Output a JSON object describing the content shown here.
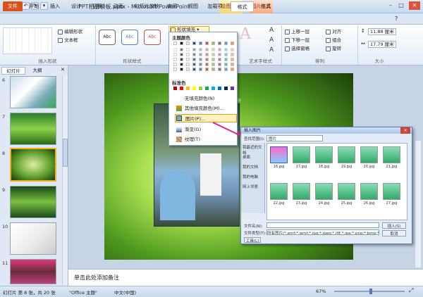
{
  "title_bar": {
    "title": "PPT相册模板.pptx - Microsoft PowerPoint",
    "context_tabs": [
      "绘图工具",
      "图片工具"
    ]
  },
  "tabs": [
    "文件",
    "开始",
    "插入",
    "设计",
    "切换",
    "动画",
    "幻灯片放映",
    "审阅",
    "视图",
    "加载项",
    "格式",
    "格式"
  ],
  "ribbon": {
    "groups": [
      "插入形状",
      "形状样式",
      "艺术字样式",
      "排列",
      "大小"
    ],
    "edit_shape": "编辑形状",
    "text_box": "文本框",
    "style_labels": [
      "Abc",
      "Abc",
      "Abc"
    ],
    "shape_fill": "形状填充",
    "arrange": {
      "bring_forward": "上移一层",
      "send_backward": "下移一层",
      "selection_pane": "选择窗格",
      "align": "对齐",
      "group": "组合",
      "rotate": "旋转"
    },
    "size": {
      "height": "11.88 厘米",
      "width": "17.79 厘米"
    }
  },
  "fill_menu": {
    "theme_colors": "主题颜色",
    "standard_colors": "标准色",
    "items": [
      "无填充颜色(N)",
      "其他填充颜色(M)...",
      "图片(P)...",
      "渐变(G)",
      "纹理(T)"
    ],
    "theme_palette": [
      "#ffffff",
      "#000000",
      "#eeece1",
      "#1f497d",
      "#4f81bd",
      "#c0504d",
      "#9bbb59",
      "#8064a2",
      "#4bacc6",
      "#f79646"
    ],
    "standard_palette": [
      "#c00000",
      "#ff0000",
      "#ffc000",
      "#ffff00",
      "#92d050",
      "#00b050",
      "#00b0f0",
      "#0070c0",
      "#002060",
      "#7030a0"
    ]
  },
  "slide_panel": {
    "tabs": [
      "幻灯片",
      "大纲"
    ],
    "numbers": [
      "6",
      "7",
      "8",
      "9",
      "10",
      "11"
    ]
  },
  "notes_placeholder": "单击此处添加备注",
  "status": {
    "slide": "幻灯片 第 8 张，共 20 张",
    "theme": "\"Office 主题\"",
    "language": "中文(中国)",
    "zoom": "67%"
  },
  "dialog": {
    "title": "插入图片",
    "look_in_label": "查找范围(I):",
    "look_in": "图片",
    "sidebar": [
      "我最近的文档",
      "桌面",
      "我的文档",
      "我的电脑",
      "网上邻居"
    ],
    "files": [
      "16.jpg",
      "17.jpg",
      "18.jpg",
      "19.jpg",
      "20.jpg",
      "21.jpg",
      "22.jpg",
      "23.jpg",
      "24.jpg",
      "25.jpg",
      "26.jpg",
      "27.jpg"
    ],
    "filename_label": "文件名(N):",
    "filetype_label": "文件类型(T):",
    "filetype": "所有图片(*.emf;*.wmf;*.jpg;*.jpeg;*.jfif;*.jpe;*.png;*.bmp;*.dib;*.rle;*.gif;*.emz;*.wmz;*.pcz;*.tif;*.tiff;*.eps;*.pct;*.pict;*.wpg)",
    "tools": "工具(L)",
    "insert": "插入(S)",
    "cancel": "取消"
  }
}
